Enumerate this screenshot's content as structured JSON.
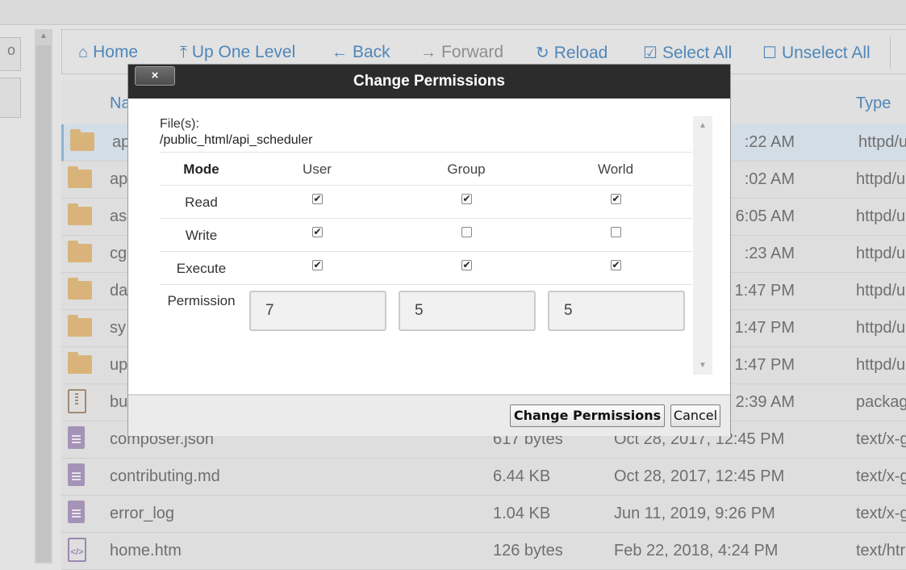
{
  "toolbar": {
    "home": "Home",
    "up_one_level": "Up One Level",
    "back": "Back",
    "forward": "Forward",
    "reload": "Reload",
    "select_all": "Select All",
    "unselect_all": "Unselect All"
  },
  "left_stub_text": "o",
  "table": {
    "header_name": "Na",
    "header_type": "Type",
    "rows": [
      {
        "name": "ap",
        "size": "",
        "date": ":22 AM",
        "type": "httpd/u",
        "icon": "folder-icon"
      },
      {
        "name": "ap",
        "size": "",
        "date": ":02 AM",
        "type": "httpd/u",
        "icon": "folder-icon"
      },
      {
        "name": "as",
        "size": "",
        "date": "6:05 AM",
        "type": "httpd/u",
        "icon": "folder-icon"
      },
      {
        "name": "cg",
        "size": "",
        "date": ":23 AM",
        "type": "httpd/u",
        "icon": "folder-icon"
      },
      {
        "name": "da",
        "size": "",
        "date": "1:47 PM",
        "type": "httpd/u",
        "icon": "folder-icon"
      },
      {
        "name": "sy",
        "size": "",
        "date": "1:47 PM",
        "type": "httpd/u",
        "icon": "folder-icon"
      },
      {
        "name": "up",
        "size": "",
        "date": "1:47 PM",
        "type": "httpd/u",
        "icon": "folder-icon"
      },
      {
        "name": "bu",
        "size": "",
        "date": "2:39 AM",
        "type": "packag",
        "icon": "zip-icon"
      },
      {
        "name": "composer.json",
        "size": "617 bytes",
        "date": "Oct 28, 2017, 12:45 PM",
        "type": "text/x-g",
        "icon": "document-icon"
      },
      {
        "name": "contributing.md",
        "size": "6.44 KB",
        "date": "Oct 28, 2017, 12:45 PM",
        "type": "text/x-g",
        "icon": "document-icon"
      },
      {
        "name": "error_log",
        "size": "1.04 KB",
        "date": "Jun 11, 2019, 9:26 PM",
        "type": "text/x-g",
        "icon": "document-icon"
      },
      {
        "name": "home.htm",
        "size": "126 bytes",
        "date": "Feb 22, 2018, 4:24 PM",
        "type": "text/htr",
        "icon": "code-file-icon"
      }
    ]
  },
  "dialog": {
    "title": "Change Permissions",
    "close_label": "×",
    "files_label": "File(s):",
    "file_path": "/public_html/api_scheduler",
    "mode_header": "Mode",
    "columns": [
      "User",
      "Group",
      "World"
    ],
    "rows": [
      {
        "label": "Read",
        "checks": [
          true,
          true,
          true
        ]
      },
      {
        "label": "Write",
        "checks": [
          true,
          false,
          false
        ]
      },
      {
        "label": "Execute",
        "checks": [
          true,
          true,
          true
        ]
      }
    ],
    "permission_label": "Permission",
    "permission_values": [
      "7",
      "5",
      "5"
    ],
    "submit_label": "Change Permissions",
    "cancel_label": "Cancel"
  }
}
